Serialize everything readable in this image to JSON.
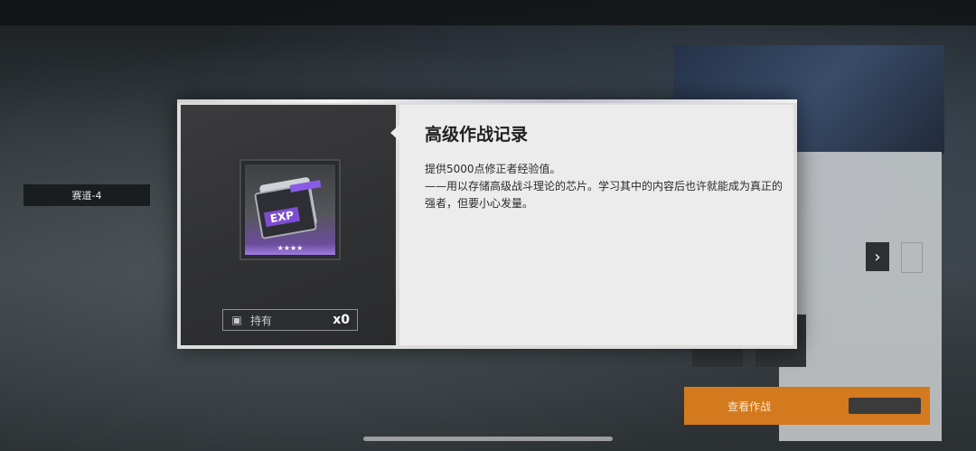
{
  "item": {
    "name": "高级作战记录",
    "icon_label": "EXP",
    "rarity_stars": "★★★★",
    "owned_label": "持有",
    "owned_count": "x0",
    "description_line1": "提供5000点修正者经验值。",
    "description_line2": "——用以存储高级战斗理论的芯片。学习其中的内容后也许就能成为真正的强者，但要小心发量。"
  },
  "background": {
    "left_tag": "赛道-4",
    "orange_button": "查看作战"
  },
  "colors": {
    "accent_purple": "#7d4dd1",
    "modal_text": "#1f1f1f",
    "left_pane": "#2f3032"
  },
  "icons": [
    "exp-chip-icon",
    "box-icon",
    "chevron-right-icon"
  ]
}
